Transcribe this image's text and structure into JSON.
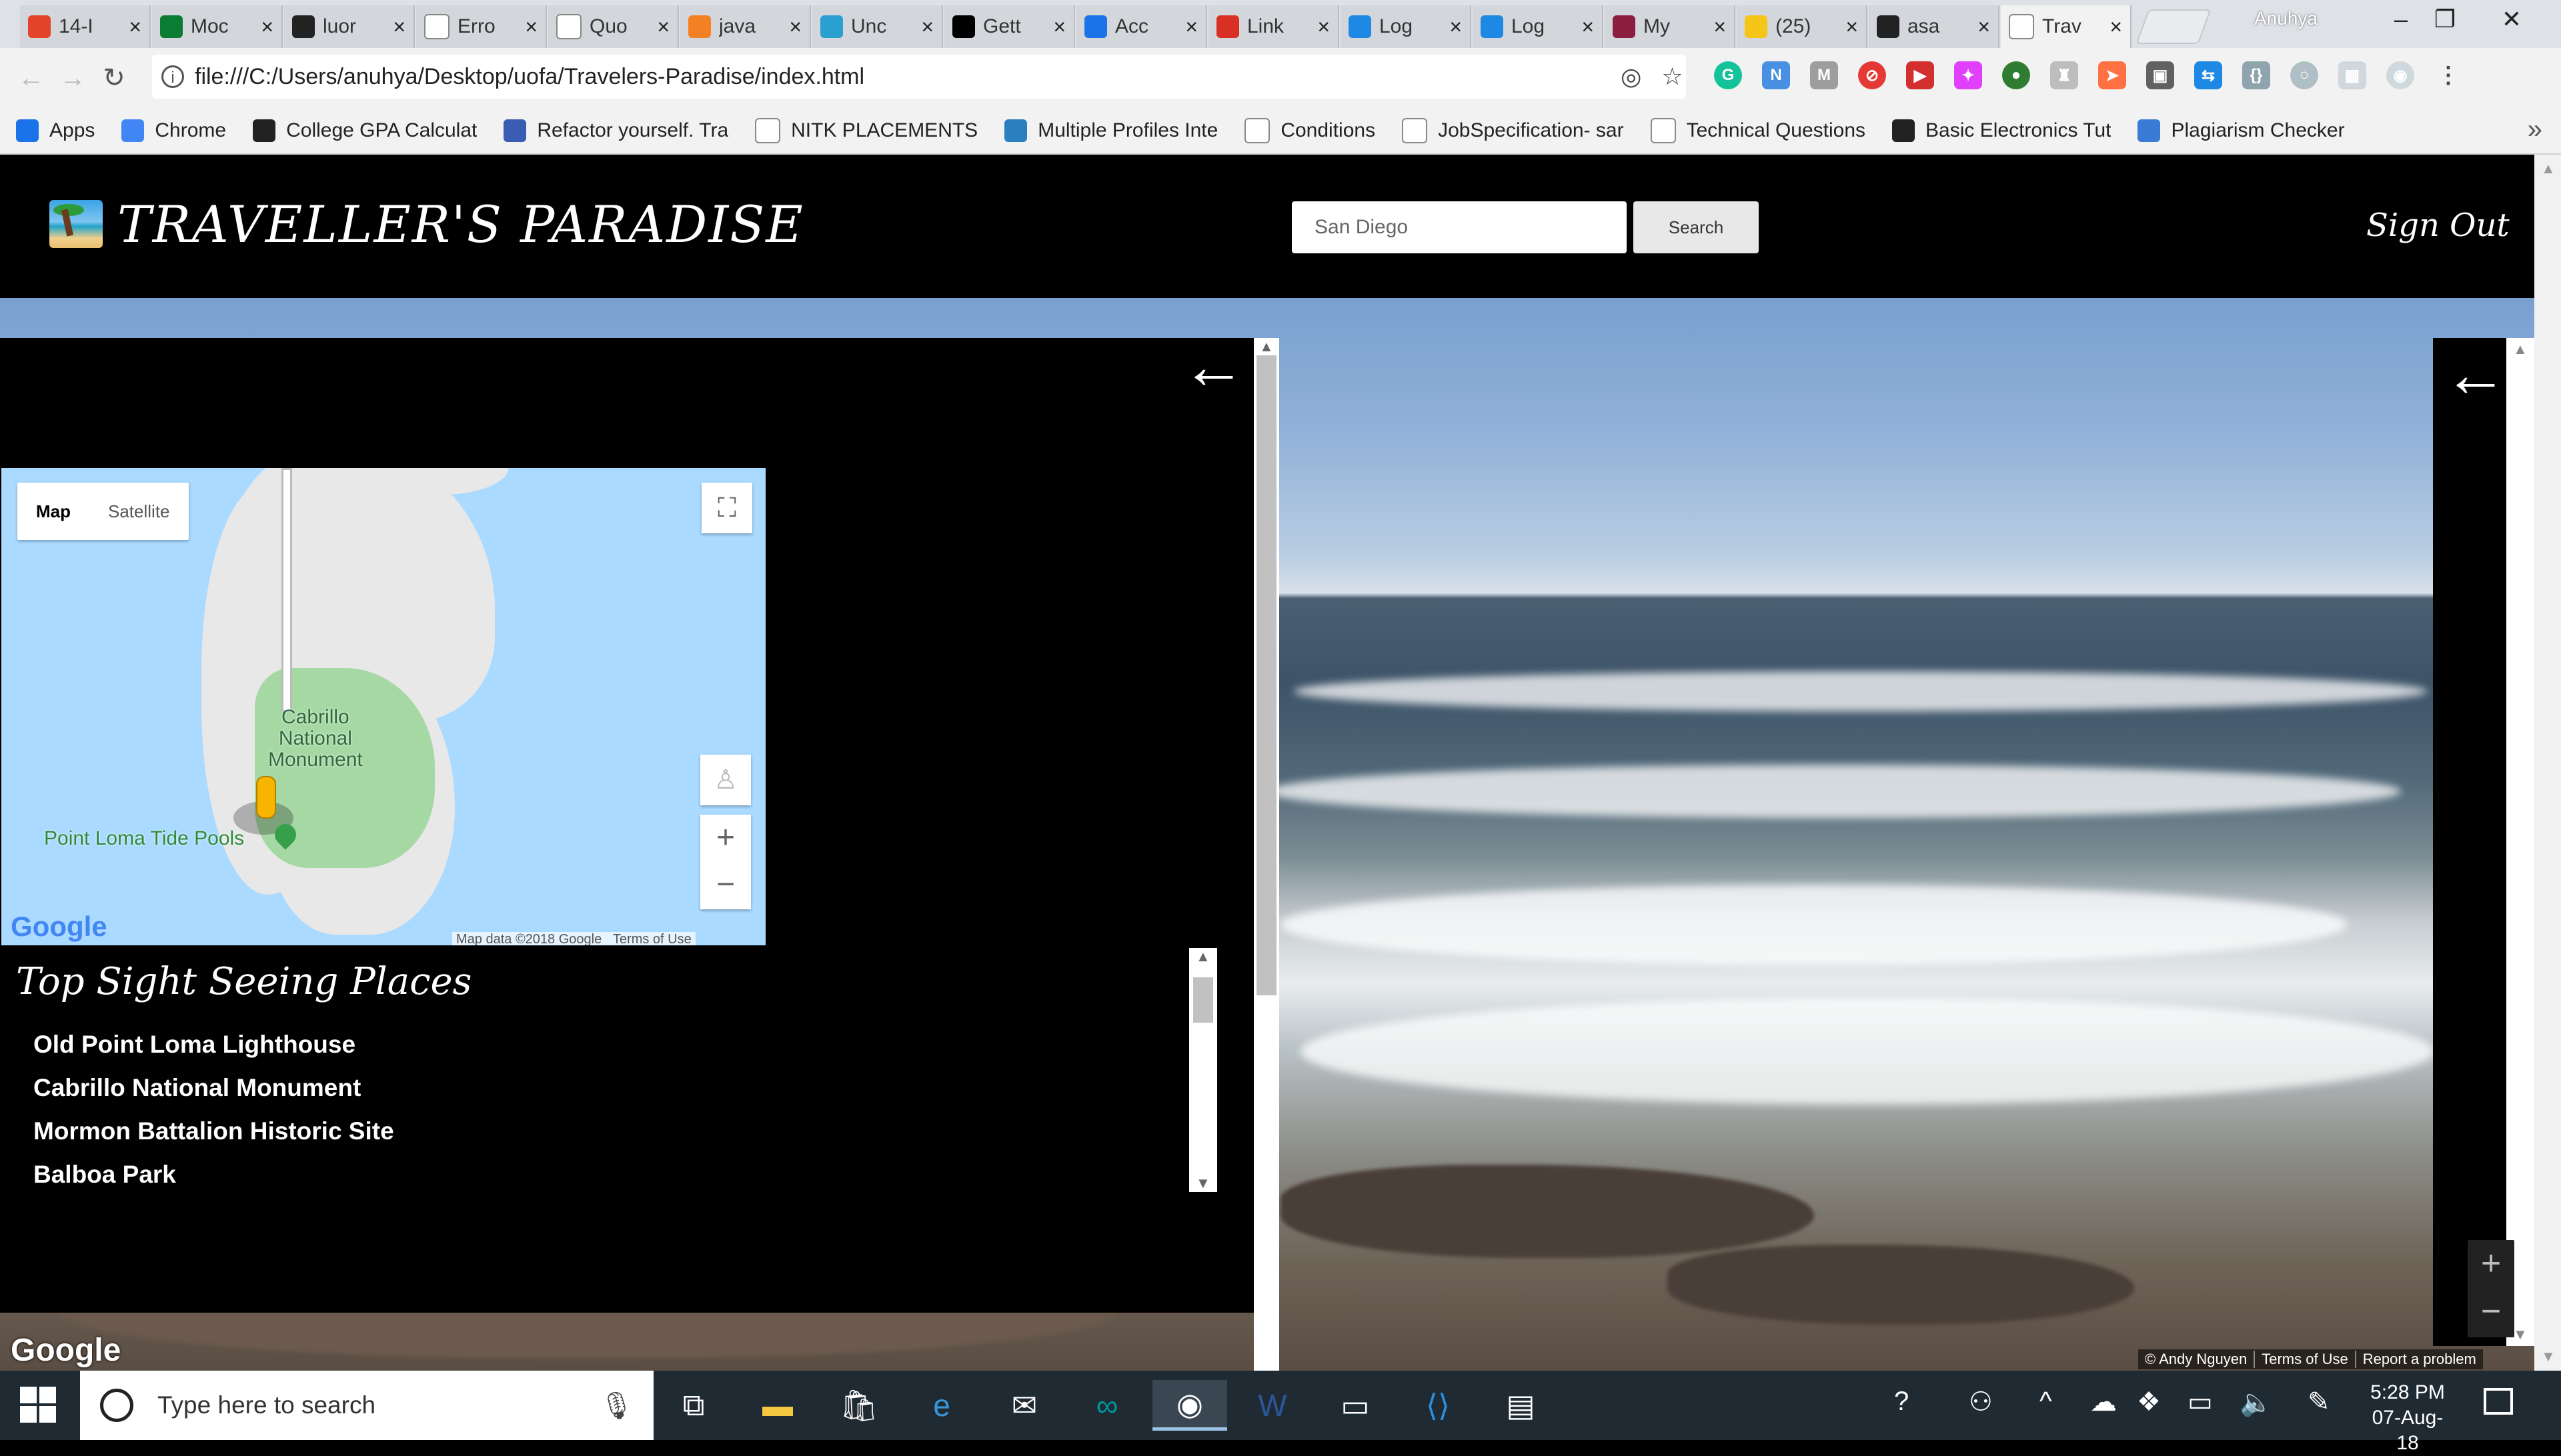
{
  "browser": {
    "tabs": [
      {
        "label": "14-I",
        "icon": "gitlab-icon",
        "color": "#e24329"
      },
      {
        "label": "Moc",
        "icon": "moodle-icon",
        "color": "#0a7d32"
      },
      {
        "label": "luor",
        "icon": "github-icon",
        "color": "#222222"
      },
      {
        "label": "Erro",
        "icon": "page-icon",
        "color": "#ffffff"
      },
      {
        "label": "Quo",
        "icon": "page-icon",
        "color": "#ffffff"
      },
      {
        "label": "java",
        "icon": "stackoverflow-icon",
        "color": "#f48024"
      },
      {
        "label": "Unc",
        "icon": "js-icon",
        "color": "#2aa0d0"
      },
      {
        "label": "Gett",
        "icon": "medium-icon",
        "color": "#000000"
      },
      {
        "label": "Acc",
        "icon": "x-icon",
        "color": "#1a73e8"
      },
      {
        "label": "Link",
        "icon": "gmail-icon",
        "color": "#d93025"
      },
      {
        "label": "Log",
        "icon": "bulb-icon",
        "color": "#1e88e5"
      },
      {
        "label": "Log",
        "icon": "bulb-icon",
        "color": "#1e88e5"
      },
      {
        "label": "My",
        "icon": "asu-icon",
        "color": "#8c1d40"
      },
      {
        "label": "(25)",
        "icon": "fleek-icon",
        "color": "#f5c518"
      },
      {
        "label": "asa",
        "icon": "github-icon",
        "color": "#222222"
      },
      {
        "label": "Trav",
        "icon": "page-icon",
        "color": "#ffffff",
        "active": true
      }
    ],
    "profile_name": "Anuhya",
    "url": "file:///C:/Users/anuhya/Desktop/uofa/Travelers-Paradise/index.html",
    "bookmarks": [
      {
        "label": "Apps",
        "icon": "apps-icon",
        "color": "#1a73e8"
      },
      {
        "label": "Chrome",
        "icon": "google-icon",
        "color": "#4285f4"
      },
      {
        "label": "College GPA Calculat",
        "icon": "g-circle-icon",
        "color": "#222222"
      },
      {
        "label": "Refactor yourself. Tra",
        "icon": "01-icon",
        "color": "#3a5db3"
      },
      {
        "label": "NITK PLACEMENTS",
        "icon": "page-icon",
        "color": "#ffffff"
      },
      {
        "label": "Multiple Profiles Inte",
        "icon": "is-icon",
        "color": "#2a7fbf"
      },
      {
        "label": "Conditions",
        "icon": "blank-icon",
        "color": "#ffffff"
      },
      {
        "label": "JobSpecification- sar",
        "icon": "page-icon",
        "color": "#ffffff"
      },
      {
        "label": "Technical Questions",
        "icon": "page-icon",
        "color": "#ffffff"
      },
      {
        "label": "Basic Electronics Tut",
        "icon": "circle-icon",
        "color": "#222222"
      },
      {
        "label": "Plagiarism Checker",
        "icon": "s-icon",
        "color": "#3a7bd5"
      }
    ],
    "more_bookmarks": "»"
  },
  "site": {
    "title": "TRAVELLER'S PARADISE",
    "search_value": "San Diego",
    "search_button": "Search",
    "sign_out": "Sign Out",
    "back_arrow": "←"
  },
  "map": {
    "type_map": "Map",
    "type_satellite": "Satellite",
    "label_park": "Cabrillo National Monument",
    "label_park_lines": [
      "Cabrillo",
      "National",
      "Monument"
    ],
    "label_poi": "Point Loma Tide Pools",
    "google_logo": "Google",
    "attribution": "Map data ©2018 Google",
    "terms": "Terms of Use",
    "zoom_in": "+",
    "zoom_out": "−",
    "fullscreen": "⛶"
  },
  "sights": {
    "title": "Top Sight Seeing Places",
    "items": [
      "Old Point Loma Lighthouse",
      "Cabrillo National Monument",
      "Mormon Battalion Historic Site",
      "Balboa Park"
    ]
  },
  "streetview": {
    "google_logo": "Google",
    "credit": "© Andy Nguyen",
    "terms": "Terms of Use",
    "report": "Report a problem",
    "zoom_in": "+",
    "zoom_out": "−"
  },
  "taskbar": {
    "search_placeholder": "Type here to search",
    "time": "5:28 PM",
    "date": "07-Aug-18"
  }
}
